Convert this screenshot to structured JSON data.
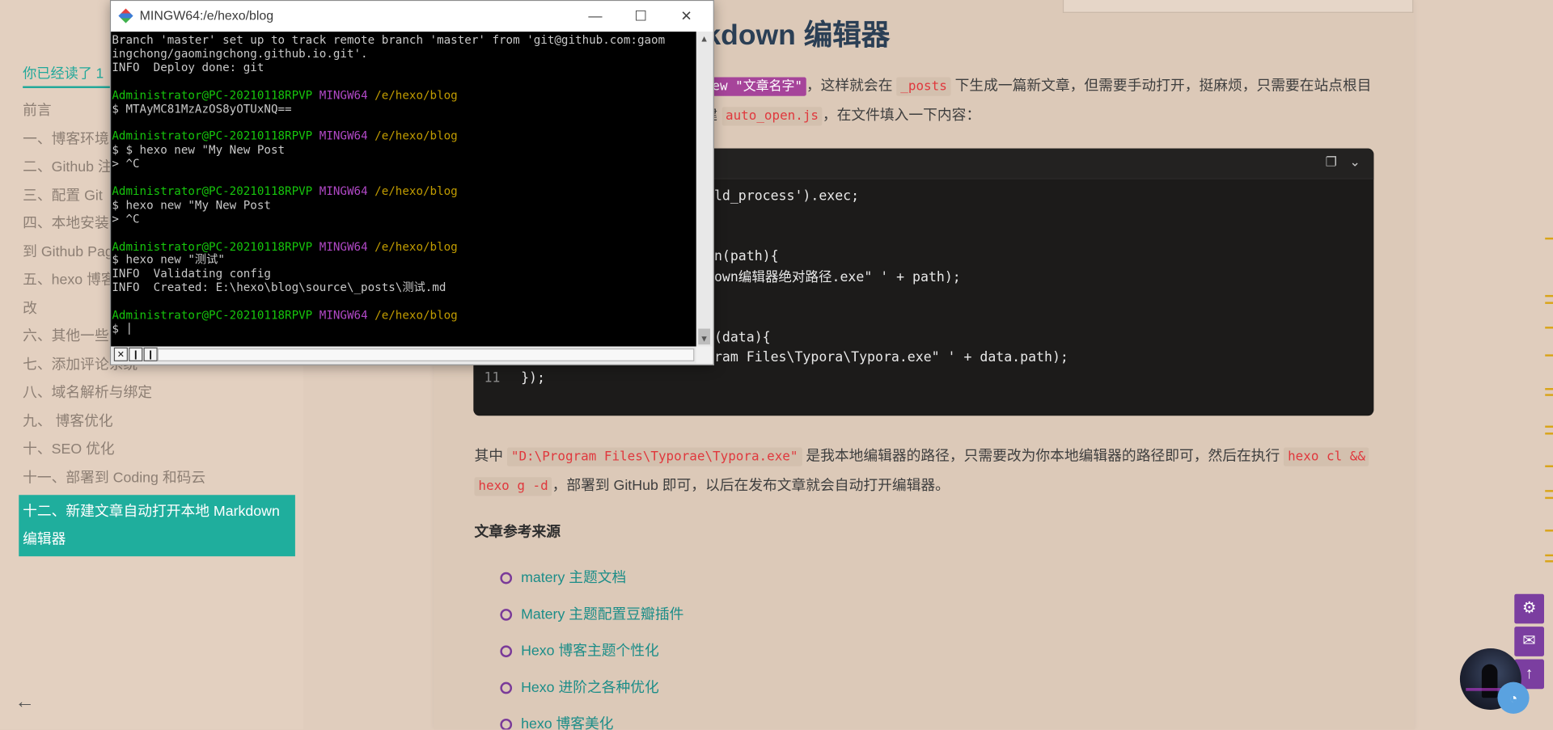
{
  "toc": {
    "read_progress": "你已经读了 1",
    "items": [
      {
        "label": "前言"
      },
      {
        "label": "一、博客环境"
      },
      {
        "label": "二、Github 注"
      },
      {
        "label": "三、配置 Git"
      },
      {
        "label": "四、本地安装"
      },
      {
        "label": "到 Github Pag"
      },
      {
        "label": "五、hexo 博客"
      },
      {
        "label": "改"
      },
      {
        "label": "六、其他一些"
      },
      {
        "label": "七、添加评论系统"
      },
      {
        "label": "八、域名解析与绑定"
      },
      {
        "label": "九、 博客优化"
      },
      {
        "label": "十、SEO 优化"
      },
      {
        "label": "十一、部署到 Coding 和码云"
      }
    ],
    "active_line1": "十二、新建文章自动打开本地 Markdown",
    "active_line2": "编辑器",
    "back_icon": "←"
  },
  "article": {
    "title": "自动打开本地 Markdown 编辑器",
    "p1_code": "ew \"文章名字\"",
    "p1_text_a": "，这样就会在",
    "p1_code2": "_posts",
    "p1_text_b": "下生成一篇新文章，但需要手动打开，挺麻烦，只需要在站点根目",
    "p2_text_a": "建",
    "p2_code": "auto_open.js",
    "p2_text_b": "，在文件填入一下内容：",
    "code_lines": [
      {
        "num": "",
        "text": "                        ld_process').exec;"
      },
      {
        "num": "",
        "text": ""
      },
      {
        "num": "",
        "text": ""
      },
      {
        "num": "",
        "text": "                        n(path){"
      },
      {
        "num": "",
        "text": "                        own编辑器绝对路径.exe\" ' + path);"
      },
      {
        "num": "",
        "text": ""
      },
      {
        "num": "",
        "text": ""
      },
      {
        "num": "",
        "text": "                        (data){"
      },
      {
        "num": "10",
        "text": "  spawn('start  \"D:\\Program Files\\Typora\\Typora.exe\" ' + data.path);"
      },
      {
        "num": "11",
        "text": "});"
      }
    ],
    "p3_text_a": "其中",
    "p3_code1": "\"D:\\Program Files\\Typorae\\Typora.exe\"",
    "p3_text_b": "是我本地编辑器的路径，只需要改为你本地编辑器的路径即可，然后在执行",
    "p3_code2": "hexo cl &&",
    "p4_code": "hexo g -d",
    "p4_text": "，部署到 GitHub 即可，以后在发布文章就会自动打开编辑器。",
    "refs_heading": "文章参考来源",
    "refs": [
      {
        "label": "matery 主题文档"
      },
      {
        "label": "Matery 主题配置豆瓣插件"
      },
      {
        "label": "Hexo 博客主题个性化"
      },
      {
        "label": "Hexo 进阶之各种优化"
      },
      {
        "label": "hexo 博客美化"
      }
    ]
  },
  "terminal": {
    "title": "MINGW64:/e/hexo/blog",
    "minimize": "—",
    "maximize": "☐",
    "close": "✕",
    "lines": [
      [
        {
          "c": "",
          "t": "Branch 'master' set up to track remote branch 'master' from 'git@github.com:gaom"
        }
      ],
      [
        {
          "c": "",
          "t": "ingchong/gaomingchong.github.io.git'."
        }
      ],
      [
        {
          "c": "",
          "t": "INFO  Deploy done: git"
        }
      ],
      [
        {
          "c": "",
          "t": ""
        }
      ],
      [
        {
          "c": "g",
          "t": "Administrator@PC-20210118RPVP "
        },
        {
          "c": "m",
          "t": "MINGW64 "
        },
        {
          "c": "y",
          "t": "/e/hexo/blog"
        }
      ],
      [
        {
          "c": "",
          "t": "$ MTAyMC81MzAzOS8yOTUxNQ=="
        }
      ],
      [
        {
          "c": "",
          "t": ""
        }
      ],
      [
        {
          "c": "g",
          "t": "Administrator@PC-20210118RPVP "
        },
        {
          "c": "m",
          "t": "MINGW64 "
        },
        {
          "c": "y",
          "t": "/e/hexo/blog"
        }
      ],
      [
        {
          "c": "",
          "t": "$ $ hexo new \"My New Post"
        }
      ],
      [
        {
          "c": "",
          "t": "> ^C"
        }
      ],
      [
        {
          "c": "",
          "t": ""
        }
      ],
      [
        {
          "c": "g",
          "t": "Administrator@PC-20210118RPVP "
        },
        {
          "c": "m",
          "t": "MINGW64 "
        },
        {
          "c": "y",
          "t": "/e/hexo/blog"
        }
      ],
      [
        {
          "c": "",
          "t": "$ hexo new \"My New Post"
        }
      ],
      [
        {
          "c": "",
          "t": "> ^C"
        }
      ],
      [
        {
          "c": "",
          "t": ""
        }
      ],
      [
        {
          "c": "g",
          "t": "Administrator@PC-20210118RPVP "
        },
        {
          "c": "m",
          "t": "MINGW64 "
        },
        {
          "c": "y",
          "t": "/e/hexo/blog"
        }
      ],
      [
        {
          "c": "",
          "t": "$ hexo new \"测试\""
        }
      ],
      [
        {
          "c": "",
          "t": "INFO  Validating config"
        }
      ],
      [
        {
          "c": "",
          "t": "INFO  Created: E:\\hexo\\blog\\source\\_posts\\测试.md"
        }
      ],
      [
        {
          "c": "",
          "t": ""
        }
      ],
      [
        {
          "c": "g",
          "t": "Administrator@PC-20210118RPVP "
        },
        {
          "c": "m",
          "t": "MINGW64 "
        },
        {
          "c": "y",
          "t": "/e/hexo/blog"
        }
      ],
      [
        {
          "c": "",
          "t": "$ "
        }
      ]
    ]
  },
  "floating": {
    "settings_icon": "⚙",
    "comment_icon": "✉",
    "top_icon": "↑",
    "chat_icon": "◔"
  },
  "colors": {
    "accent_teal": "#1fae9d",
    "accent_purple": "#7b3ea0",
    "code_red": "#e0383d"
  }
}
